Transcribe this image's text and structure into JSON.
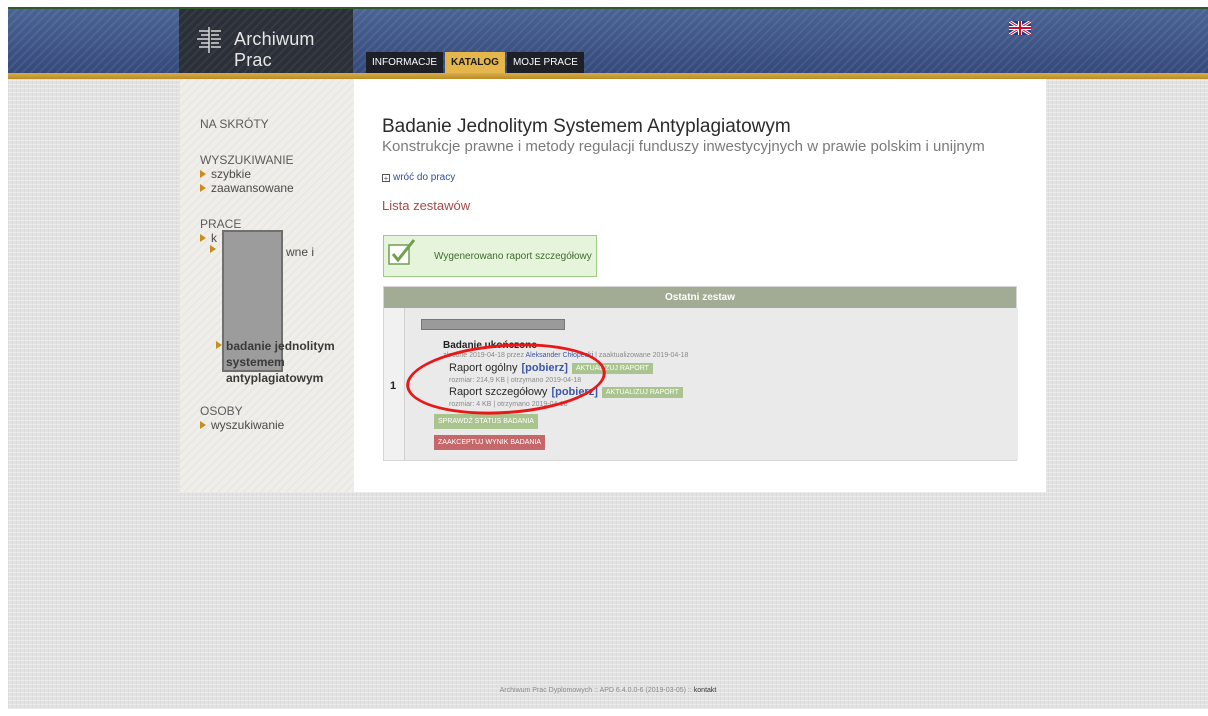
{
  "header": {
    "logo_text": "Archiwum Prac",
    "tabs": [
      {
        "label": "INFORMACJE",
        "active": false
      },
      {
        "label": "KATALOG",
        "active": true
      },
      {
        "label": "MOJE PRACE",
        "active": false
      }
    ],
    "language_flag_icon": "uk-flag-icon"
  },
  "sidebar": {
    "shortcuts": "NA SKRÓTY",
    "search_heading": "WYSZUKIWANIE",
    "search_links": [
      "szybkie",
      "zaawansowane"
    ],
    "works_heading": "PRACE",
    "works_link_partial": "k",
    "works_sub_partial": "wne i",
    "current_item_lines": [
      "badanie jednolitym",
      "systemem",
      "antyplagiatowym"
    ],
    "people_heading": "OSOBY",
    "people_links": [
      "wyszukiwanie"
    ]
  },
  "main": {
    "title": "Badanie Jednolitym Systemem Antyplagiatowym",
    "subtitle": "Konstrukcje prawne i metody regulacji funduszy inwestycyjnych w prawie polskim i unijnym",
    "back_link": "wróć do pracy",
    "list_title": "Lista zestawów",
    "notice": "Wygenerowano raport szczegółowy",
    "panel_header": "Ostatni zestaw",
    "row_number": "1",
    "status": "Badanie ukończone",
    "ordered_meta_prefix": "zlecone 2019-04-18 przez",
    "ordered_by": "Aleksander Chłopecki",
    "ordered_meta_suffix": "| zaaktualizowane 2019-04-18",
    "general_report_label": "Raport ogólny",
    "download_label": "[pobierz]",
    "update_report_label": "AKTUALIZUJ RAPORT",
    "general_report_meta": "rozmiar: 214,9 KB | otrzymano 2019-04-18",
    "detailed_report_label": "Raport szczegółowy",
    "detailed_report_meta": "rozmiar: 4 KB | otrzymano 2019-04-18",
    "check_status_button": "SPRAWDŹ STATUS BADANIA",
    "accept_button": "ZAAKCEPTUJ WYNIK BADANIA"
  },
  "footer": {
    "text": "Archiwum Prac Dyplomowych :: APD 6.4.0.0-6 (2019-03-05) ::",
    "contact": "kontakt"
  },
  "colors": {
    "header_blue": "#3e5585",
    "gold": "#d9ad4a",
    "active_tab": "#e4b64c",
    "panel_header": "#a2ab94",
    "accept_red": "#c6676a",
    "annotation_red": "#e81818"
  }
}
